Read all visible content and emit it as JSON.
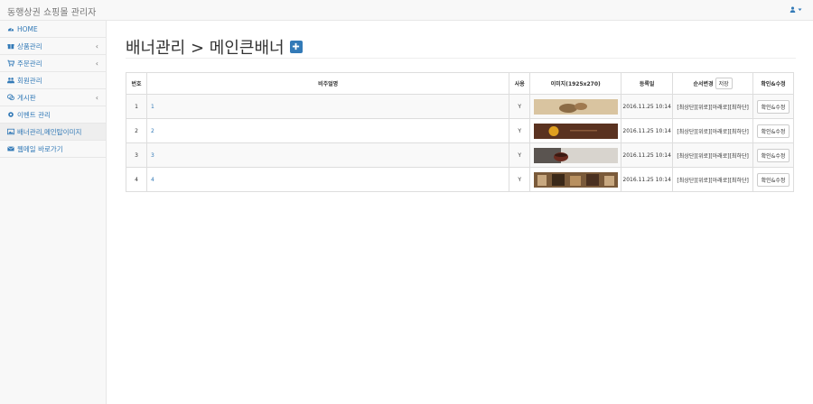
{
  "app": {
    "title": "동행상권 쇼핑몰 관리자"
  },
  "sidebar": {
    "items": [
      {
        "label": "HOME",
        "icon": "dashboard-icon",
        "chevron": false,
        "active": false
      },
      {
        "label": "상품관리",
        "icon": "gift-icon",
        "chevron": true,
        "active": false
      },
      {
        "label": "주문관리",
        "icon": "cart-icon",
        "chevron": true,
        "active": false
      },
      {
        "label": "회원관리",
        "icon": "users-icon",
        "chevron": false,
        "active": false
      },
      {
        "label": "게시판",
        "icon": "comments-icon",
        "chevron": true,
        "active": false
      },
      {
        "label": "이벤트 관리",
        "icon": "gear-icon",
        "chevron": false,
        "active": false
      },
      {
        "label": "배너관리,메인탑이미지",
        "icon": "picture-icon",
        "chevron": false,
        "active": true
      },
      {
        "label": "웹메일 바로가기",
        "icon": "envelope-icon",
        "chevron": false,
        "active": false
      }
    ]
  },
  "page": {
    "title": "배너관리 > 메인큰배너"
  },
  "table": {
    "headers": {
      "num": "번호",
      "desc": "비주얼명",
      "use": "사용",
      "image": "이미지(1925x270)",
      "date": "등록일",
      "order": "순서변경",
      "save": "저장",
      "edit": "확인&수정"
    },
    "rows": [
      {
        "num": "1",
        "desc": "1",
        "use": "Y",
        "date": "2016.11.25 10:14",
        "order": "[최상단][위로][아래로][최하단]",
        "edit": "확인&수정",
        "thumb_colors": [
          "#d9c4a0",
          "#8b6b45"
        ]
      },
      {
        "num": "2",
        "desc": "2",
        "use": "Y",
        "date": "2016.11.25 10:14",
        "order": "[최상단][위로][아래로][최하단]",
        "edit": "확인&수정",
        "thumb_colors": [
          "#5a3220",
          "#e0a020"
        ]
      },
      {
        "num": "3",
        "desc": "3",
        "use": "Y",
        "date": "2016.11.25 10:14",
        "order": "[최상단][위로][아래로][최하단]",
        "edit": "확인&수정",
        "thumb_colors": [
          "#d8d4ce",
          "#6a2a1e"
        ]
      },
      {
        "num": "4",
        "desc": "4",
        "use": "Y",
        "date": "2016.11.25 10:14",
        "order": "[최상단][위로][아래로][최하단]",
        "edit": "확인&수정",
        "thumb_colors": [
          "#7a5a3a",
          "#c8a880"
        ]
      }
    ]
  },
  "colors": {
    "link": "#337ab7",
    "accent": "#337ab7"
  }
}
